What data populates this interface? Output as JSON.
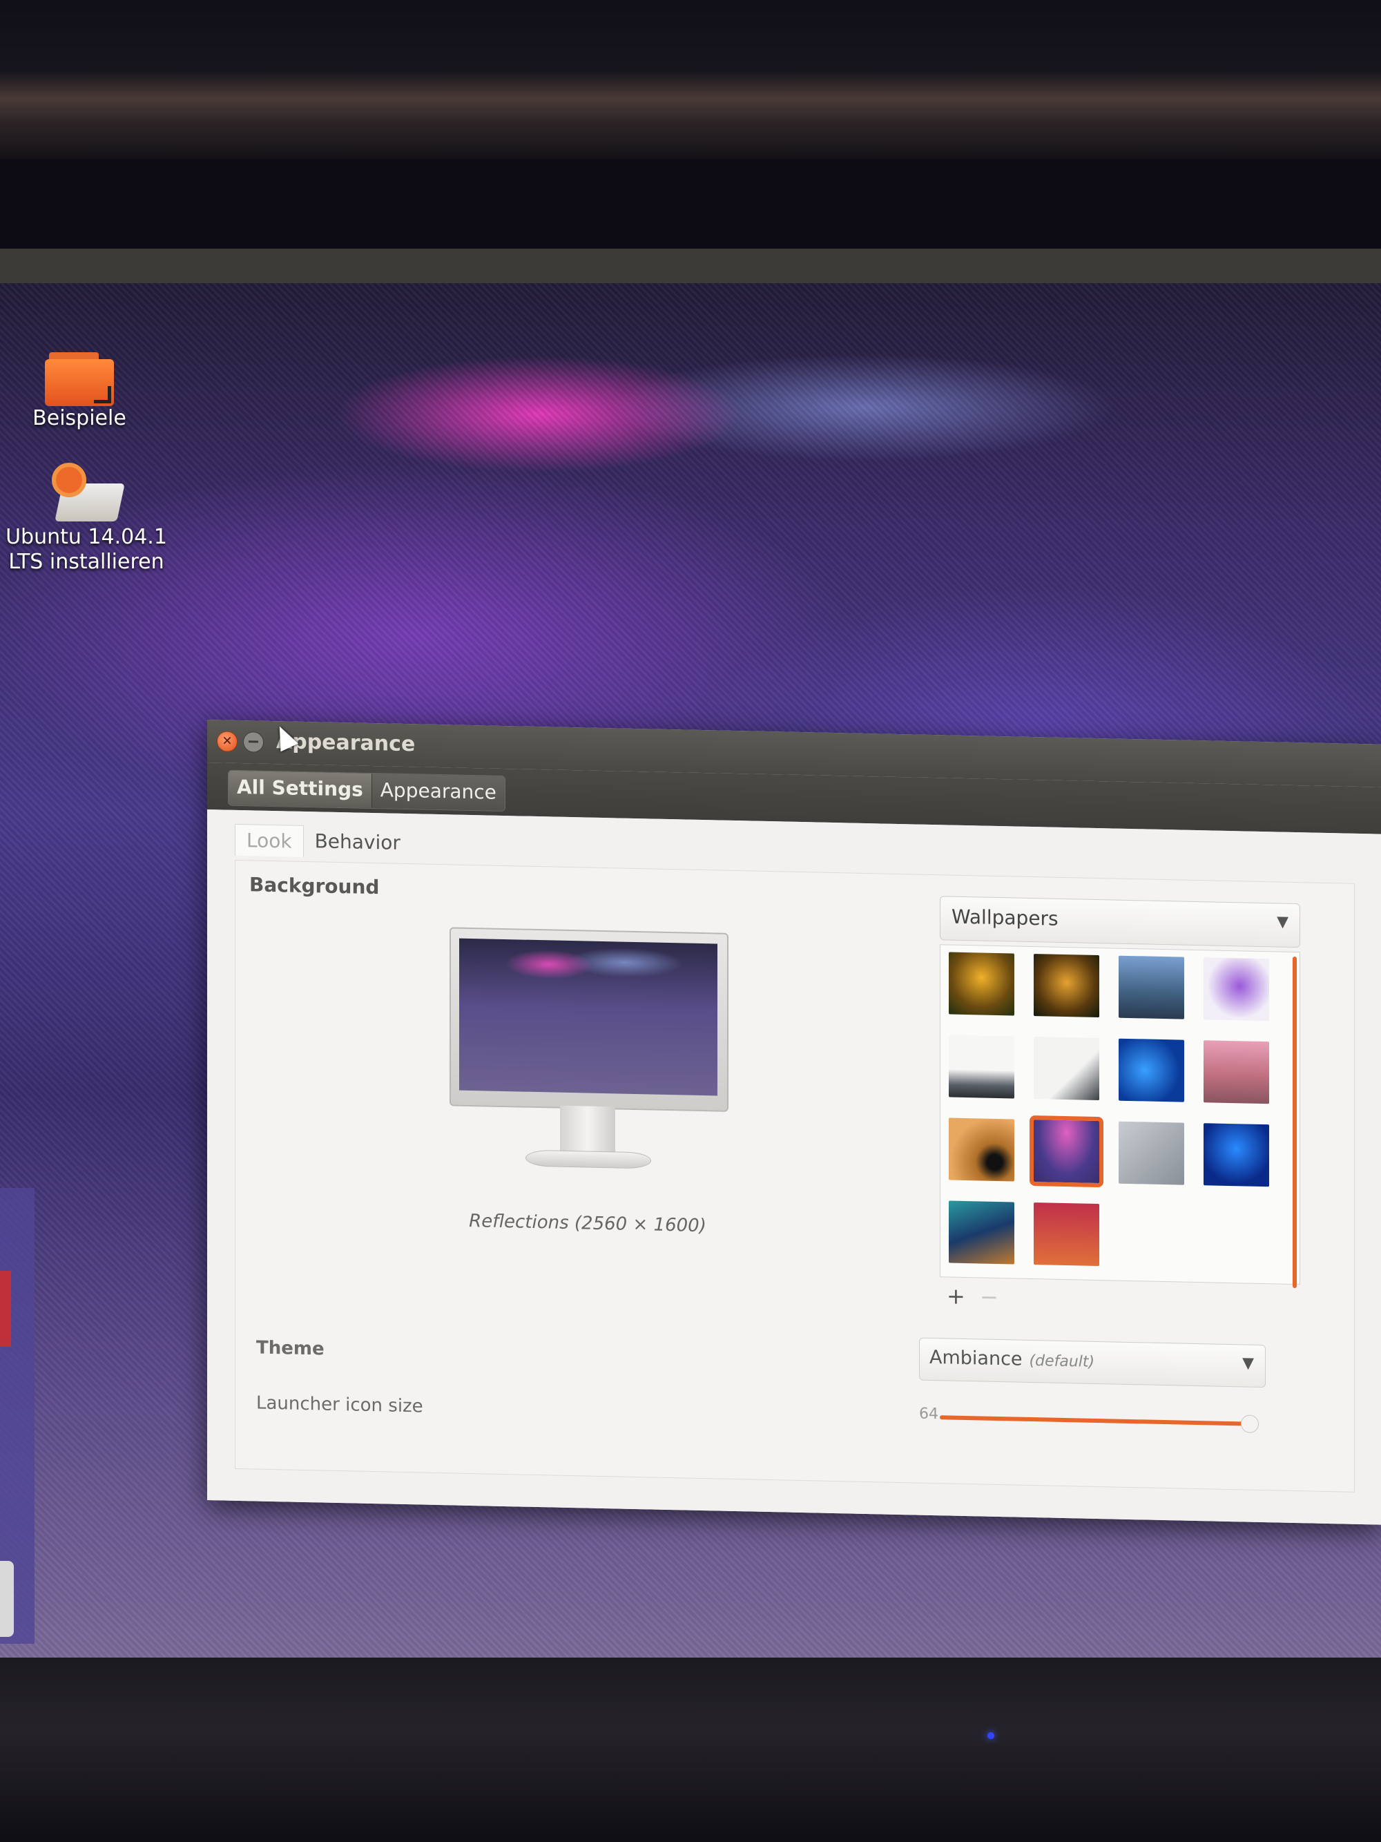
{
  "desktop": {
    "icons": [
      {
        "label": "Beispiele"
      },
      {
        "label": "Ubuntu 14.04.1 LTS installieren"
      }
    ],
    "accent_color": "#e8662a"
  },
  "window": {
    "title": "Appearance",
    "breadcrumb": [
      "All Settings",
      "Appearance"
    ],
    "tabs": [
      "Look",
      "Behavior"
    ],
    "active_tab": "Look",
    "background": {
      "section_label": "Background",
      "caption": "Reflections (2560 × 1600)",
      "source_select": "Wallpapers",
      "selected_index": 9,
      "add_label": "+",
      "remove_label": "−"
    },
    "theme": {
      "label": "Theme",
      "value": "Ambiance",
      "value_note": "(default)"
    },
    "launcher": {
      "label": "Launcher icon size",
      "value": "64",
      "slider_level": 1.0
    }
  }
}
